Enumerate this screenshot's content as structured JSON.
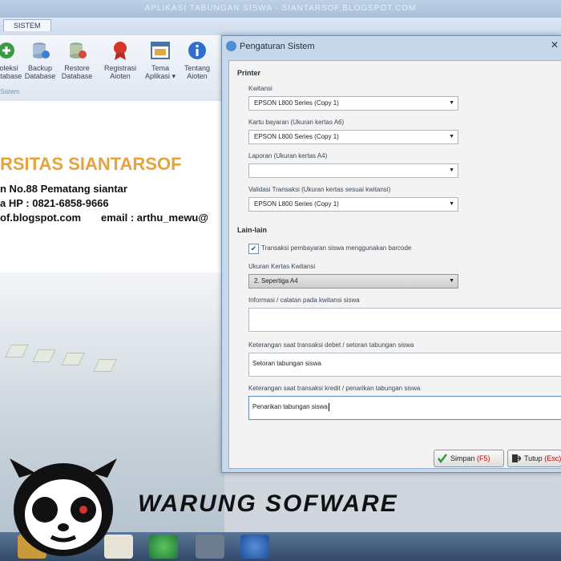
{
  "window": {
    "title": "APLIKASI TABUNGAN SISWA - SIANTARSOF.BLOGSPOT.COM"
  },
  "ribbon": {
    "tab": "SISTEM",
    "group": "Sistem",
    "buttons": [
      {
        "label1": "Koleksi",
        "label2": "Database"
      },
      {
        "label1": "Backup",
        "label2": "Database"
      },
      {
        "label1": "Restore",
        "label2": "Database"
      },
      {
        "label1": "Registrasi",
        "label2": "Aioten"
      },
      {
        "label1": "Tema",
        "label2": "Aplikasi ▾"
      },
      {
        "label1": "Tentang",
        "label2": "Aioten"
      }
    ]
  },
  "background_doc": {
    "school_name": "RSITAS SIANTARSOF",
    "address": "n No.88 Pematang siantar",
    "phone": "a HP : 0821-6858-9666",
    "web": "of.blogspot.com",
    "email": "email : arthu_mewu@"
  },
  "dialog": {
    "title": "Pengaturan Sistem",
    "close_glyph": "✕",
    "printer": {
      "heading": "Printer",
      "fields": [
        {
          "label": "Kwitansi",
          "value": "EPSON L800 Series (Copy 1)"
        },
        {
          "label": "Kartu bayaran (Ukuran kertas A6)",
          "value": "EPSON L800 Series (Copy 1)"
        },
        {
          "label": "Laporan (Ukuran kertas A4)",
          "value": ""
        },
        {
          "label": "Validasi Transaksi (Ukuran kertas sesuai kwitansi)",
          "value": "EPSON L800 Series (Copy 1)"
        }
      ]
    },
    "lain": {
      "heading": "Lain-lain",
      "checkbox_label": "Transaksi pembayaran siswa menggunakan barcode",
      "checkbox_checked": true,
      "ukuran_label": "Ukuran Kertas Kwitansi",
      "ukuran_value": "2. Sepertiga A4",
      "informasi_label": "Informasi / catatan pada kwitansi siswa",
      "informasi_value": "",
      "debet_label": "Keterangan saat transaksi debet / setoran tabungan siswa",
      "debet_value": "Setoran tabungan siswa",
      "kredit_label": "Keterangan saat transaksi kredit / penarikan tabungan siswa",
      "kredit_value": "Penarikan tabungan siswa"
    },
    "buttons": {
      "save_label": "Simpan",
      "save_key": "(F5)",
      "close_label": "Tutup",
      "close_key": "(Esc)"
    }
  },
  "watermark": {
    "brand": "WARUNG SOFWARE"
  },
  "colors": {
    "school_orange": "#e8a23c",
    "dialog_frame": "#c7d8ea",
    "taskbar": "#3c5576"
  }
}
